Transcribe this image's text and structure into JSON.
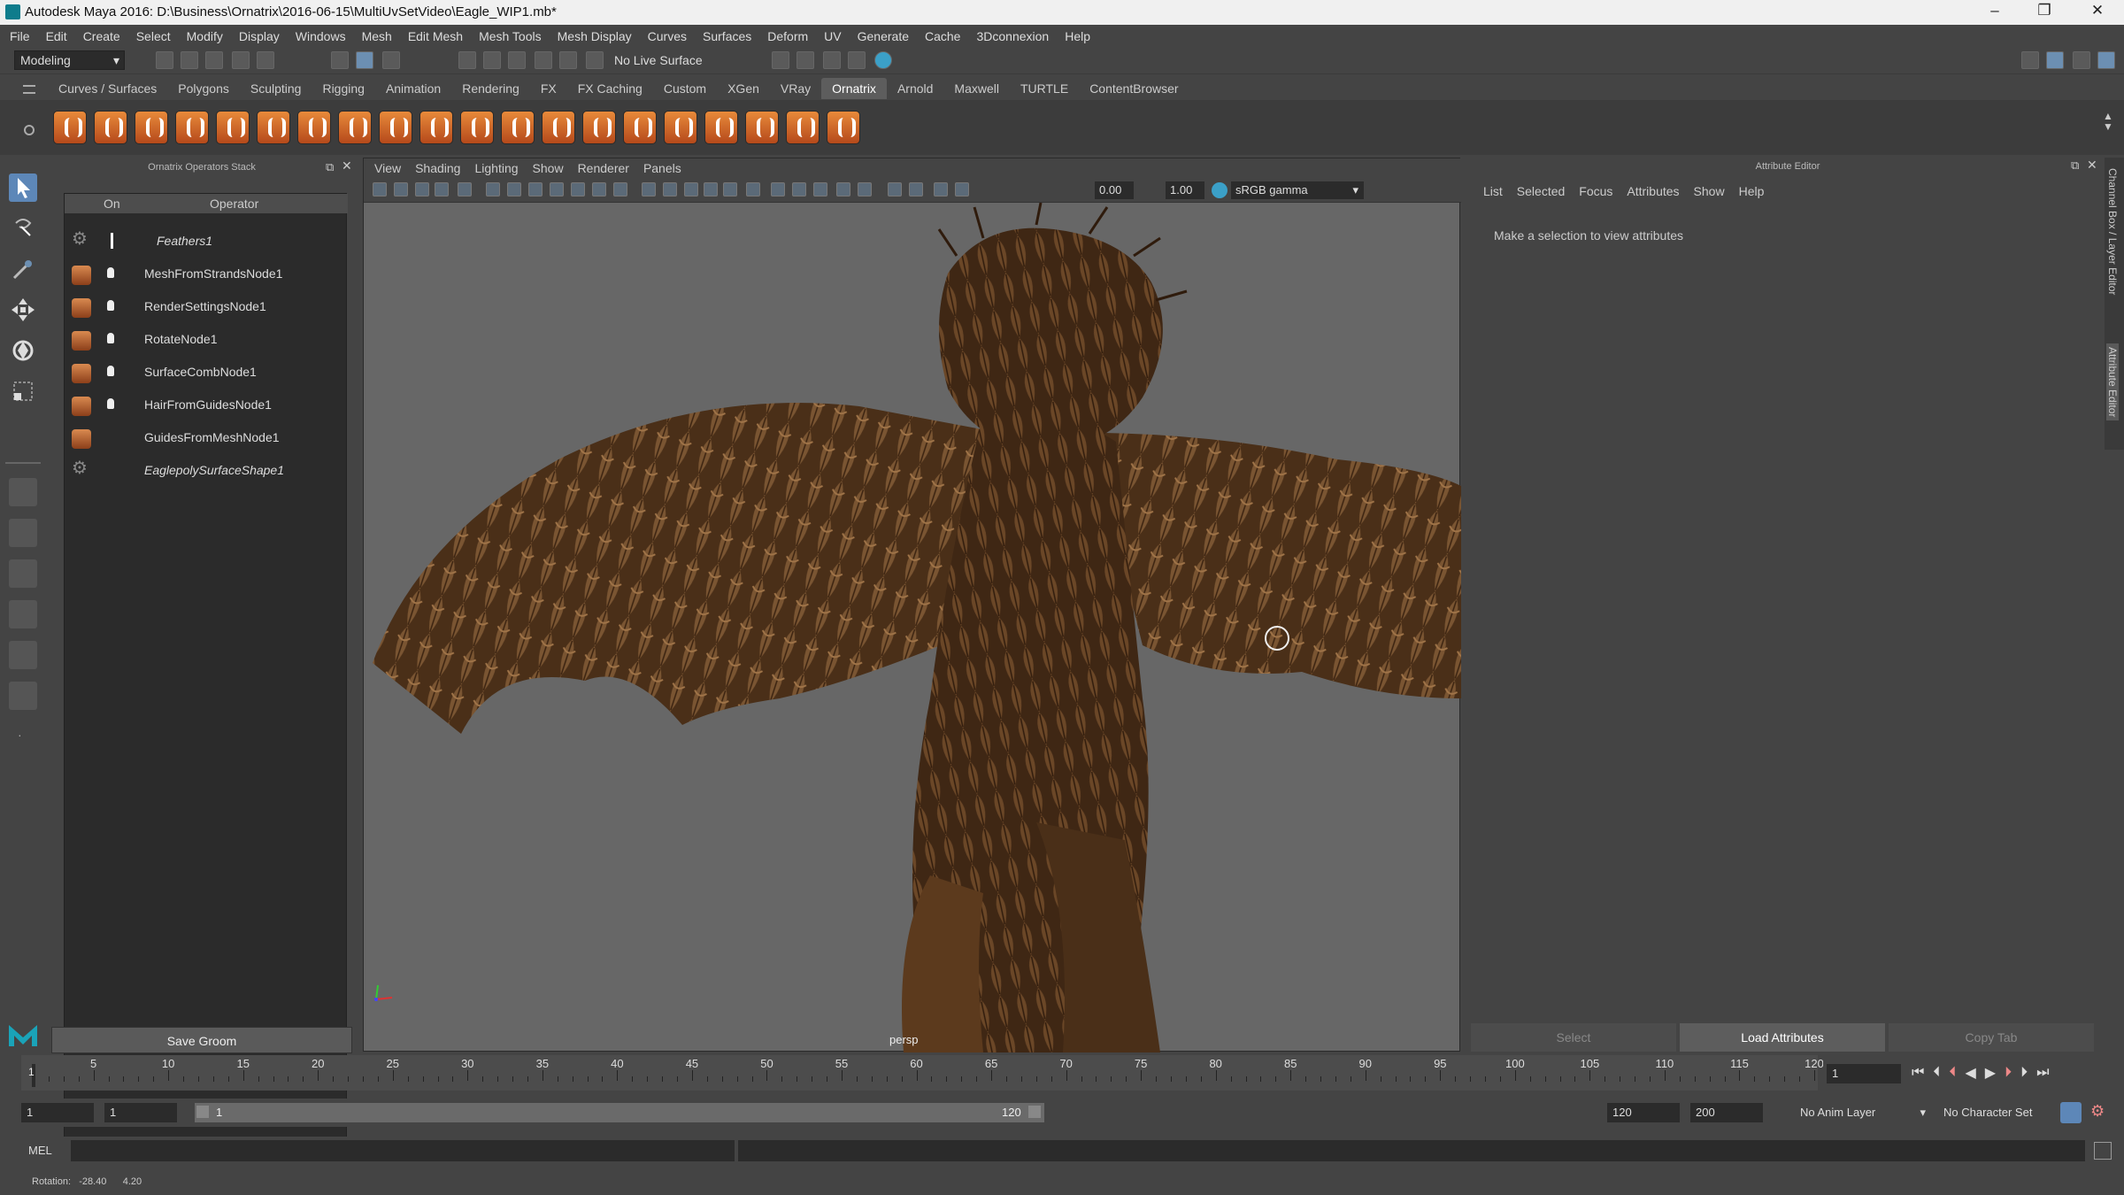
{
  "window": {
    "title": "Autodesk Maya 2016: D:\\Business\\Ornatrix\\2016-06-15\\MultiUvSetVideo\\Eagle_WIP1.mb*",
    "minimize": "–",
    "restore": "❐",
    "close": "✕"
  },
  "menubar": [
    "File",
    "Edit",
    "Create",
    "Select",
    "Modify",
    "Display",
    "Windows",
    "Mesh",
    "Edit Mesh",
    "Mesh Tools",
    "Mesh Display",
    "Curves",
    "Surfaces",
    "Deform",
    "UV",
    "Generate",
    "Cache",
    "3Dconnexion",
    "Help"
  ],
  "statusline": {
    "mode": "Modeling",
    "live_surface": "No Live Surface"
  },
  "shelf_tabs": [
    "Curves / Surfaces",
    "Polygons",
    "Sculpting",
    "Rigging",
    "Animation",
    "Rendering",
    "FX",
    "FX Caching",
    "Custom",
    "XGen",
    "VRay",
    "Ornatrix",
    "Arnold",
    "Maxwell",
    "TURTLE",
    "ContentBrowser"
  ],
  "active_shelf": "Ornatrix",
  "shelf_icon_count": 20,
  "operators_panel": {
    "title": "Ornatrix Operators Stack",
    "col_on": "On",
    "col_operator": "Operator",
    "rows": [
      {
        "label": "Feathers1",
        "icon": "gear-icon",
        "italic": true
      },
      {
        "label": "MeshFromStrandsNode1",
        "icon": "hair-strand-icon"
      },
      {
        "label": "RenderSettingsNode1",
        "icon": "render-settings-icon"
      },
      {
        "label": "RotateNode1",
        "icon": "rotate-icon"
      },
      {
        "label": "SurfaceCombNode1",
        "icon": "comb-icon"
      },
      {
        "label": "HairFromGuidesNode1",
        "icon": "hair-guides-icon"
      },
      {
        "label": "GuidesFromMeshNode1",
        "icon": "guides-mesh-icon"
      },
      {
        "label": "EaglepolySurfaceShape1",
        "icon": "gear-icon",
        "italic": true
      }
    ],
    "save_button": "Save Groom"
  },
  "viewport": {
    "menu": [
      "View",
      "Shading",
      "Lighting",
      "Show",
      "Renderer",
      "Panels"
    ],
    "exposure": "0.00",
    "gamma": "1.00",
    "color_space": "sRGB gamma",
    "camera": "persp"
  },
  "attribute_editor": {
    "title": "Attribute Editor",
    "menu": [
      "List",
      "Selected",
      "Focus",
      "Attributes",
      "Show",
      "Help"
    ],
    "message": "Make a selection to view attributes",
    "buttons": {
      "select": "Select",
      "load": "Load Attributes",
      "copy_tab": "Copy Tab"
    }
  },
  "side_tabs": [
    "Channel Box / Layer Editor",
    "Attribute Editor"
  ],
  "timeline": {
    "labels": [
      "5",
      "10",
      "15",
      "20",
      "25",
      "30",
      "35",
      "40",
      "45",
      "50",
      "55",
      "60",
      "65",
      "70",
      "75",
      "80",
      "85",
      "90",
      "95",
      "100",
      "105",
      "110",
      "115",
      "120"
    ],
    "start_marker": "1",
    "current_frame": "1"
  },
  "range": {
    "start": "1",
    "anim_start": "1",
    "range_start_label": "1",
    "range_end_label": "120",
    "end": "120",
    "anim_end": "200",
    "anim_layer": "No Anim Layer",
    "character_set": "No Character Set"
  },
  "mel": {
    "label": "MEL"
  },
  "helpline": {
    "text": "Rotation:   -28.40      4.20"
  }
}
